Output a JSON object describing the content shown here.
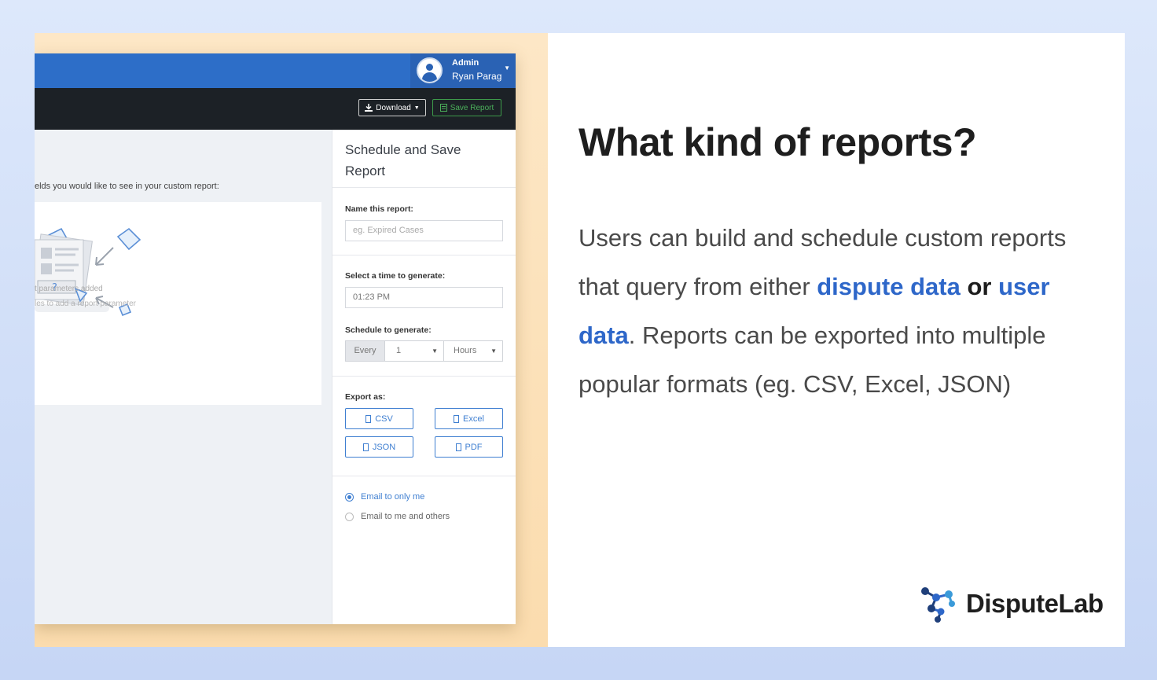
{
  "app": {
    "user": {
      "role": "Admin",
      "name": "Ryan Parag"
    },
    "toolbar": {
      "download_label": "Download",
      "save_label": "Save Report"
    },
    "main": {
      "instruction": "elds you would like to see in your custom report:",
      "empty_line1": "t parameters added",
      "empty_line2": "les to add a report parameter"
    },
    "sidebar": {
      "title": "Schedule and Save Report",
      "name_label": "Name this report:",
      "name_placeholder": "eg. Expired Cases",
      "time_label": "Select a time to generate:",
      "time_value": "01:23 PM",
      "schedule_label": "Schedule to generate:",
      "schedule_every": "Every",
      "schedule_number": "1",
      "schedule_unit": "Hours",
      "export_label": "Export as:",
      "formats": [
        "CSV",
        "Excel",
        "JSON",
        "PDF"
      ],
      "email_options": [
        "Email to only me",
        "Email to me and others"
      ],
      "email_selected": "Email to only me"
    }
  },
  "content": {
    "heading": "What kind of reports?",
    "body_part1": "Users can build and schedule custom reports that query from either ",
    "link1": "dispute data",
    "connector": "or",
    "link2": "user data",
    "body_part2": ". Reports can be exported into multiple popular formats (eg. CSV, Excel, JSON)"
  },
  "brand": {
    "name": "DisputeLab"
  },
  "colors": {
    "accent_blue": "#2e67c9",
    "topbar_blue": "#2d6ec8",
    "toolbar_dark": "#1c2126",
    "save_green": "#4bb05a",
    "peach": "#fbdcae"
  },
  "icons": [
    "user-avatar-icon",
    "download-icon",
    "save-icon",
    "file-icon",
    "illustration-documents"
  ]
}
